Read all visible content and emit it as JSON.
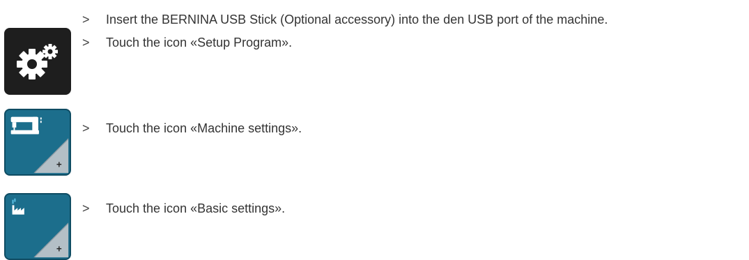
{
  "steps": [
    {
      "marker": ">",
      "text": "Insert the BERNINA USB Stick (Optional accessory) into the den USB port of the machine."
    },
    {
      "marker": ">",
      "text": "Touch the icon «Setup Program»."
    },
    {
      "marker": ">",
      "text": "Touch the icon «Machine settings»."
    },
    {
      "marker": ">",
      "text": "Touch the icon «Basic settings»."
    }
  ],
  "icons": {
    "setup_program": {
      "name": "gears-icon",
      "color": "#1e1e1e"
    },
    "machine_settings": {
      "name": "sewing-machine-icon",
      "color": "#1c6e8c"
    },
    "basic_settings": {
      "name": "factory-icon",
      "color": "#1c6e8c"
    }
  }
}
